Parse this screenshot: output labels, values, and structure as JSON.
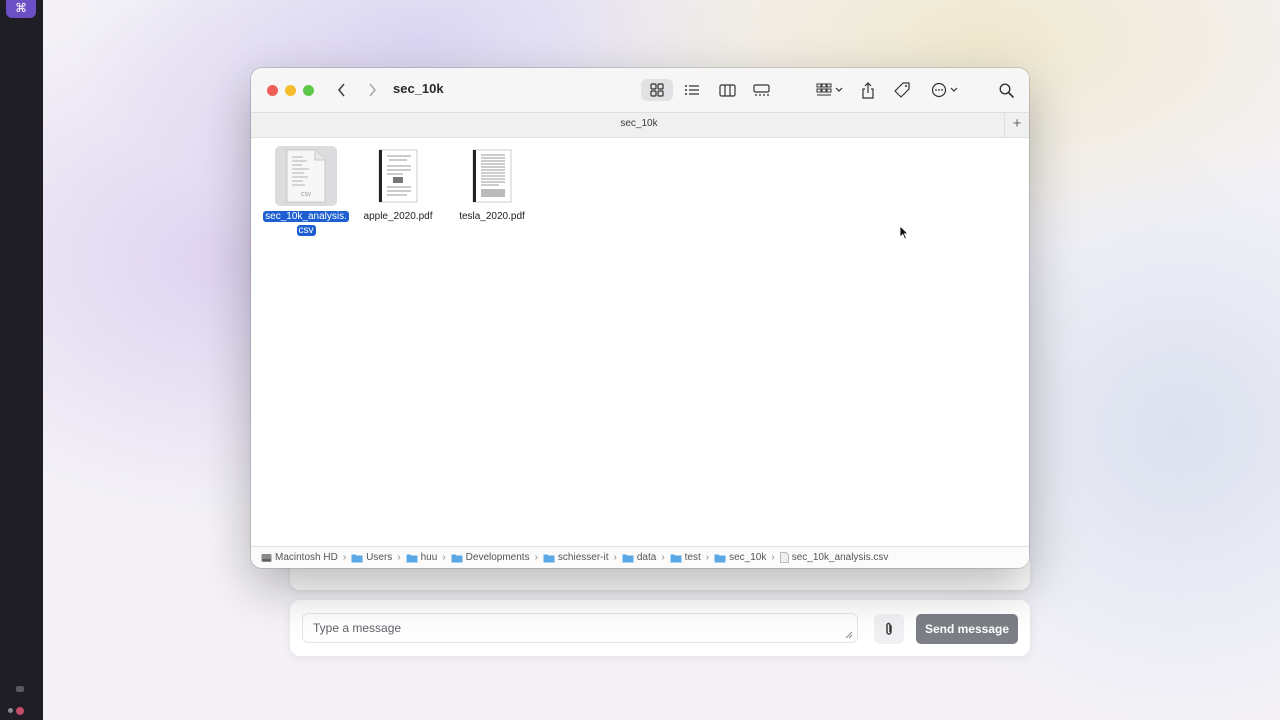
{
  "finder": {
    "title": "sec_10k",
    "tab_title": "sec_10k",
    "tab_add": "+",
    "files": [
      {
        "name_line1": "sec_10k_analysis.",
        "name_line2": "csv",
        "thumb_label": "CSV",
        "selected": true
      },
      {
        "name": "apple_2020.pdf",
        "selected": false
      },
      {
        "name": "tesla_2020.pdf",
        "selected": false
      }
    ],
    "path": [
      "Macintosh HD",
      "Users",
      "huu",
      "Developments",
      "schiesser-it",
      "data",
      "test",
      "sec_10k",
      "sec_10k_analysis.csv"
    ],
    "path_separator": "›"
  },
  "chat": {
    "placeholder": "Type a message",
    "send_label": "Send message"
  },
  "colors": {
    "selection": "#1d5fd1",
    "send_button": "#7c7f86",
    "dock": "#1f1d26"
  }
}
